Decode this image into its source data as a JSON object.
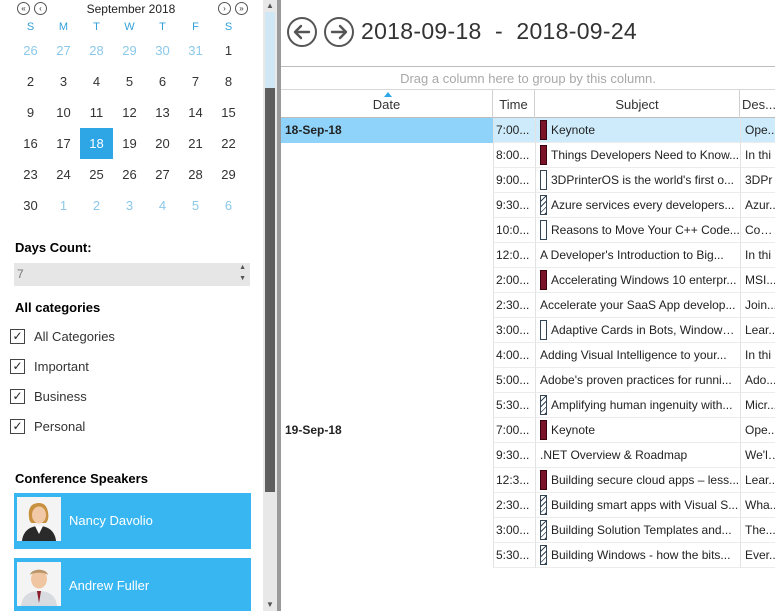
{
  "calendar": {
    "month_title": "September 2018",
    "nav": {
      "prev_year": "«",
      "prev_month": "‹",
      "next_month": "›",
      "next_year": "»"
    },
    "weekdays": [
      "S",
      "M",
      "T",
      "W",
      "T",
      "F",
      "S"
    ],
    "weeks": [
      [
        {
          "d": "26",
          "o": true
        },
        {
          "d": "27",
          "o": true
        },
        {
          "d": "28",
          "o": true
        },
        {
          "d": "29",
          "o": true
        },
        {
          "d": "30",
          "o": true
        },
        {
          "d": "31",
          "o": true
        },
        {
          "d": "1"
        }
      ],
      [
        {
          "d": "2"
        },
        {
          "d": "3"
        },
        {
          "d": "4"
        },
        {
          "d": "5"
        },
        {
          "d": "6"
        },
        {
          "d": "7"
        },
        {
          "d": "8"
        }
      ],
      [
        {
          "d": "9"
        },
        {
          "d": "10"
        },
        {
          "d": "11"
        },
        {
          "d": "12"
        },
        {
          "d": "13"
        },
        {
          "d": "14"
        },
        {
          "d": "15"
        }
      ],
      [
        {
          "d": "16"
        },
        {
          "d": "17"
        },
        {
          "d": "18",
          "s": true
        },
        {
          "d": "19"
        },
        {
          "d": "20"
        },
        {
          "d": "21"
        },
        {
          "d": "22"
        }
      ],
      [
        {
          "d": "23"
        },
        {
          "d": "24"
        },
        {
          "d": "25"
        },
        {
          "d": "26"
        },
        {
          "d": "27"
        },
        {
          "d": "28"
        },
        {
          "d": "29"
        }
      ],
      [
        {
          "d": "30"
        },
        {
          "d": "1",
          "o": true
        },
        {
          "d": "2",
          "o": true
        },
        {
          "d": "3",
          "o": true
        },
        {
          "d": "4",
          "o": true
        },
        {
          "d": "5",
          "o": true
        },
        {
          "d": "6",
          "o": true
        }
      ]
    ]
  },
  "days_count": {
    "label": "Days Count:",
    "value": "7"
  },
  "categories": {
    "title": "All categories",
    "items": [
      {
        "label": "All Categories",
        "checked": "✓"
      },
      {
        "label": "Important",
        "checked": "✓"
      },
      {
        "label": "Business",
        "checked": "✓"
      },
      {
        "label": "Personal",
        "checked": "✓"
      }
    ]
  },
  "speakers": {
    "title": "Conference Speakers",
    "items": [
      {
        "name": "Nancy Davolio"
      },
      {
        "name": "Andrew Fuller"
      }
    ]
  },
  "header": {
    "date_range": "2018-09-18  -  2018-09-24"
  },
  "grid": {
    "group_panel": "Drag a column here to group by this column.",
    "columns": [
      "Date",
      "Time",
      "Subject",
      "Des..."
    ],
    "rows": [
      {
        "date": "18-Sep-18",
        "time": "7:00...",
        "subject": "Keynote",
        "desc": "Ope...",
        "cat": "important",
        "sel": true
      },
      {
        "date": "",
        "time": "8:00...",
        "subject": "Things Developers Need to Know...",
        "desc": "In thi",
        "cat": "important"
      },
      {
        "date": "",
        "time": "9:00...",
        "subject": "3DPrinterOS is the world's first o...",
        "desc": "3DPr",
        "cat": "business"
      },
      {
        "date": "",
        "time": "9:30...",
        "subject": "Azure services every developers...",
        "desc": "Azur...",
        "cat": "personal"
      },
      {
        "date": "",
        "time": "10:0...",
        "subject": "Reasons to Move Your C++ Code...",
        "desc": "Com...",
        "cat": "business"
      },
      {
        "date": "",
        "time": "12:0...",
        "subject": "A Developer's Introduction to Big...",
        "desc": "In thi",
        "cat": "none"
      },
      {
        "date": "",
        "time": "2:00...",
        "subject": "Accelerating Windows 10 enterpr...",
        "desc": "MSI...",
        "cat": "important"
      },
      {
        "date": "",
        "time": "2:30...",
        "subject": "Accelerate your SaaS App develop...",
        "desc": "Join...",
        "cat": "none"
      },
      {
        "date": "",
        "time": "3:00...",
        "subject": "Adaptive Cards in Bots, Windows,...",
        "desc": "Lear...",
        "cat": "business"
      },
      {
        "date": "",
        "time": "4:00...",
        "subject": "Adding Visual Intelligence to your...",
        "desc": "In thi",
        "cat": "none"
      },
      {
        "date": "",
        "time": "5:00...",
        "subject": "Adobe's proven practices for runni...",
        "desc": "Ado...",
        "cat": "none"
      },
      {
        "date": "",
        "time": "5:30...",
        "subject": "Amplifying human ingenuity with...",
        "desc": "Micr...",
        "cat": "personal"
      },
      {
        "date": "19-Sep-18",
        "time": "7:00...",
        "subject": "Keynote",
        "desc": "Ope...",
        "cat": "important"
      },
      {
        "date": "",
        "time": "9:30...",
        "subject": ".NET Overview & Roadmap",
        "desc": "We'll...",
        "cat": "none"
      },
      {
        "date": "",
        "time": "12:3...",
        "subject": "Building secure cloud apps – less...",
        "desc": "Lear...",
        "cat": "important"
      },
      {
        "date": "",
        "time": "2:30...",
        "subject": "Building smart apps with Visual S...",
        "desc": "Wha...",
        "cat": "personal"
      },
      {
        "date": "",
        "time": "3:00...",
        "subject": "Building Solution Templates and...",
        "desc": "The...",
        "cat": "personal"
      },
      {
        "date": "",
        "time": "5:30...",
        "subject": "Building Windows - how the bits...",
        "desc": "Ever...",
        "cat": "personal"
      }
    ]
  }
}
